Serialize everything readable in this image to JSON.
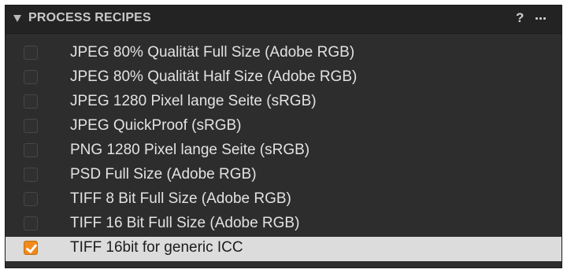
{
  "panel": {
    "title": "PROCESS RECIPES",
    "help_label": "?",
    "more_icon": "ellipsis-icon",
    "collapse_icon": "triangle-down-icon"
  },
  "recipes": [
    {
      "label": "JPEG 80% Qualität Full Size (Adobe RGB)",
      "checked": false
    },
    {
      "label": "JPEG 80% Qualität Half Size (Adobe RGB)",
      "checked": false
    },
    {
      "label": "JPEG 1280 Pixel lange Seite (sRGB)",
      "checked": false
    },
    {
      "label": "JPEG QuickProof (sRGB)",
      "checked": false
    },
    {
      "label": "PNG 1280 Pixel lange Seite (sRGB)",
      "checked": false
    },
    {
      "label": "PSD Full Size (Adobe RGB)",
      "checked": false
    },
    {
      "label": "TIFF 8 Bit Full Size (Adobe RGB)",
      "checked": false
    },
    {
      "label": "TIFF 16 Bit Full Size (Adobe RGB)",
      "checked": false
    },
    {
      "label": "TIFF 16bit for generic ICC",
      "checked": true,
      "selected": true
    }
  ],
  "colors": {
    "panel_bg": "#2d2d2d",
    "header_bg": "#232323",
    "selected_row_bg": "#dcdcdc",
    "checkbox_checked": "#f08a1c"
  }
}
